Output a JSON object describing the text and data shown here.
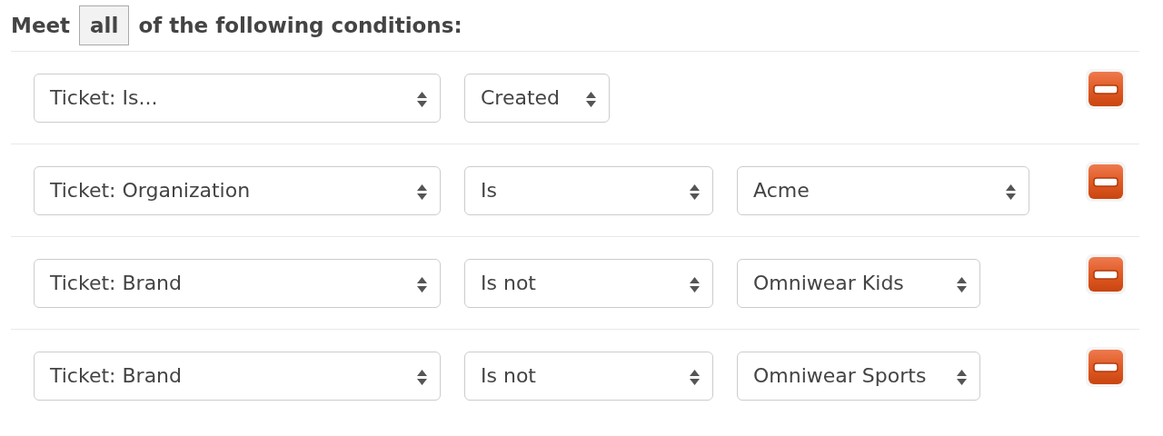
{
  "heading": {
    "before": "Meet",
    "match_mode": "all",
    "after": "of the following conditions:"
  },
  "conditions": [
    {
      "field": "Ticket: Is...",
      "operator": "Created"
    },
    {
      "field": "Ticket: Organization",
      "operator": "Is",
      "value": "Acme"
    },
    {
      "field": "Ticket: Brand",
      "operator": "Is not",
      "value": "Omniwear Kids"
    },
    {
      "field": "Ticket: Brand",
      "operator": "Is not",
      "value": "Omniwear Sports"
    }
  ]
}
